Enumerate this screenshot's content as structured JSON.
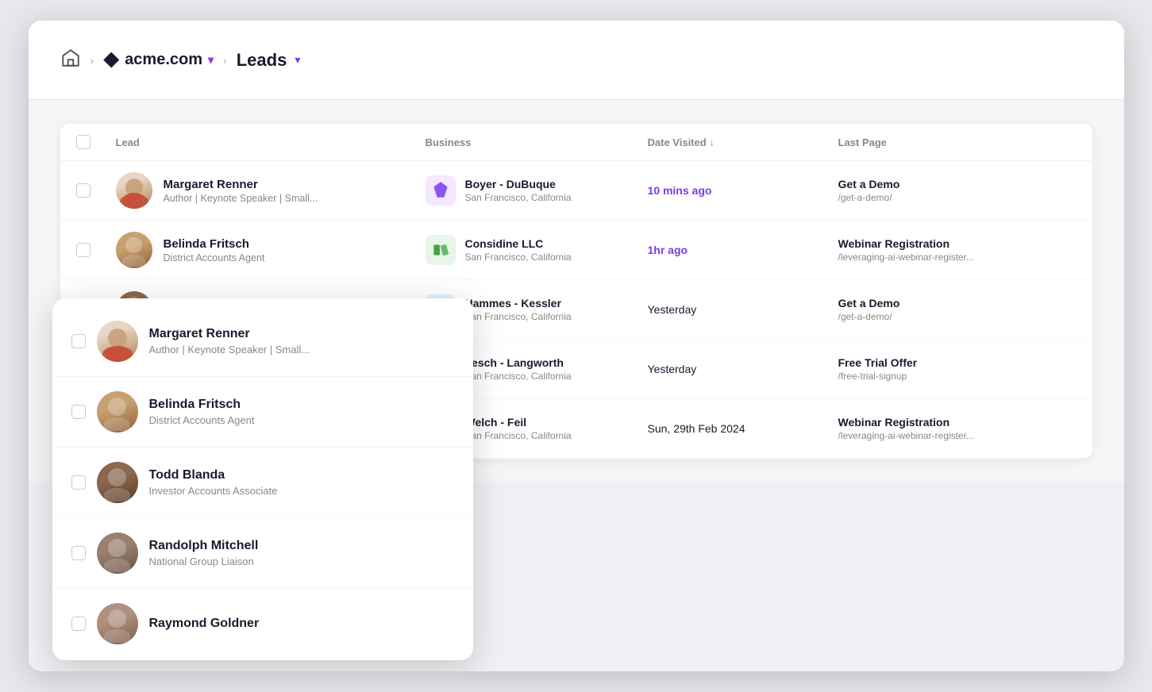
{
  "breadcrumb": {
    "home_label": "Home",
    "brand_label": "acme.com",
    "leads_label": "Leads",
    "chevron": "▾"
  },
  "table": {
    "headers": [
      "Lead",
      "Business",
      "Date Visited",
      "Last Page"
    ],
    "rows": [
      {
        "id": "margaret",
        "name": "Margaret Renner",
        "title": "Author | Keynote Speaker | Small...",
        "business": "Boyer - DuBuque",
        "location": "San Francisco, California",
        "date": "10 mins ago",
        "date_class": "recent",
        "last_page_title": "Get a Demo",
        "last_page_url": "/get-a-demo/"
      },
      {
        "id": "belinda",
        "name": "Belinda Fritsch",
        "title": "District Accounts Agent",
        "business": "Considine LLC",
        "location": "San Francisco, California",
        "date": "1hr ago",
        "date_class": "recent",
        "last_page_title": "Webinar Registration",
        "last_page_url": "/leveraging-ai-webinar-register..."
      },
      {
        "id": "todd",
        "name": "Todd Blanda",
        "title": "Investor Accounts Associate",
        "business": "Hammes - Kessler",
        "location": "San Francisco, California",
        "date": "Yesterday",
        "date_class": "",
        "last_page_title": "Get a Demo",
        "last_page_url": "/get-a-demo/"
      },
      {
        "id": "randolph",
        "name": "Randolph Mitchell",
        "title": "National Group Liaison",
        "business": "Lesch - Langworth",
        "location": "San Francisco, California",
        "date": "Yesterday",
        "date_class": "",
        "last_page_title": "Free Trial Offer",
        "last_page_url": "/free-trial-signup"
      },
      {
        "id": "raymond",
        "name": "Raymond Goldner",
        "title": "",
        "business": "Welch - Feil",
        "location": "San Francisco, California",
        "date": "Sun, 29th Feb 2024",
        "date_class": "",
        "last_page_title": "Webinar Registration",
        "last_page_url": "/leveraging-ai-webinar-register..."
      }
    ]
  },
  "panel": {
    "rows": [
      {
        "id": "margaret",
        "name": "Margaret Renner",
        "title": "Author | Keynote Speaker | Small..."
      },
      {
        "id": "belinda",
        "name": "Belinda Fritsch",
        "title": "District Accounts Agent"
      },
      {
        "id": "todd",
        "name": "Todd Blanda",
        "title": "Investor Accounts Associate"
      },
      {
        "id": "randolph",
        "name": "Randolph Mitchell",
        "title": "National Group Liaison"
      },
      {
        "id": "raymond",
        "name": "Raymond Goldner",
        "title": ""
      }
    ]
  },
  "colors": {
    "accent": "#7c3aed",
    "text_primary": "#1a1a2e",
    "text_secondary": "#888"
  }
}
